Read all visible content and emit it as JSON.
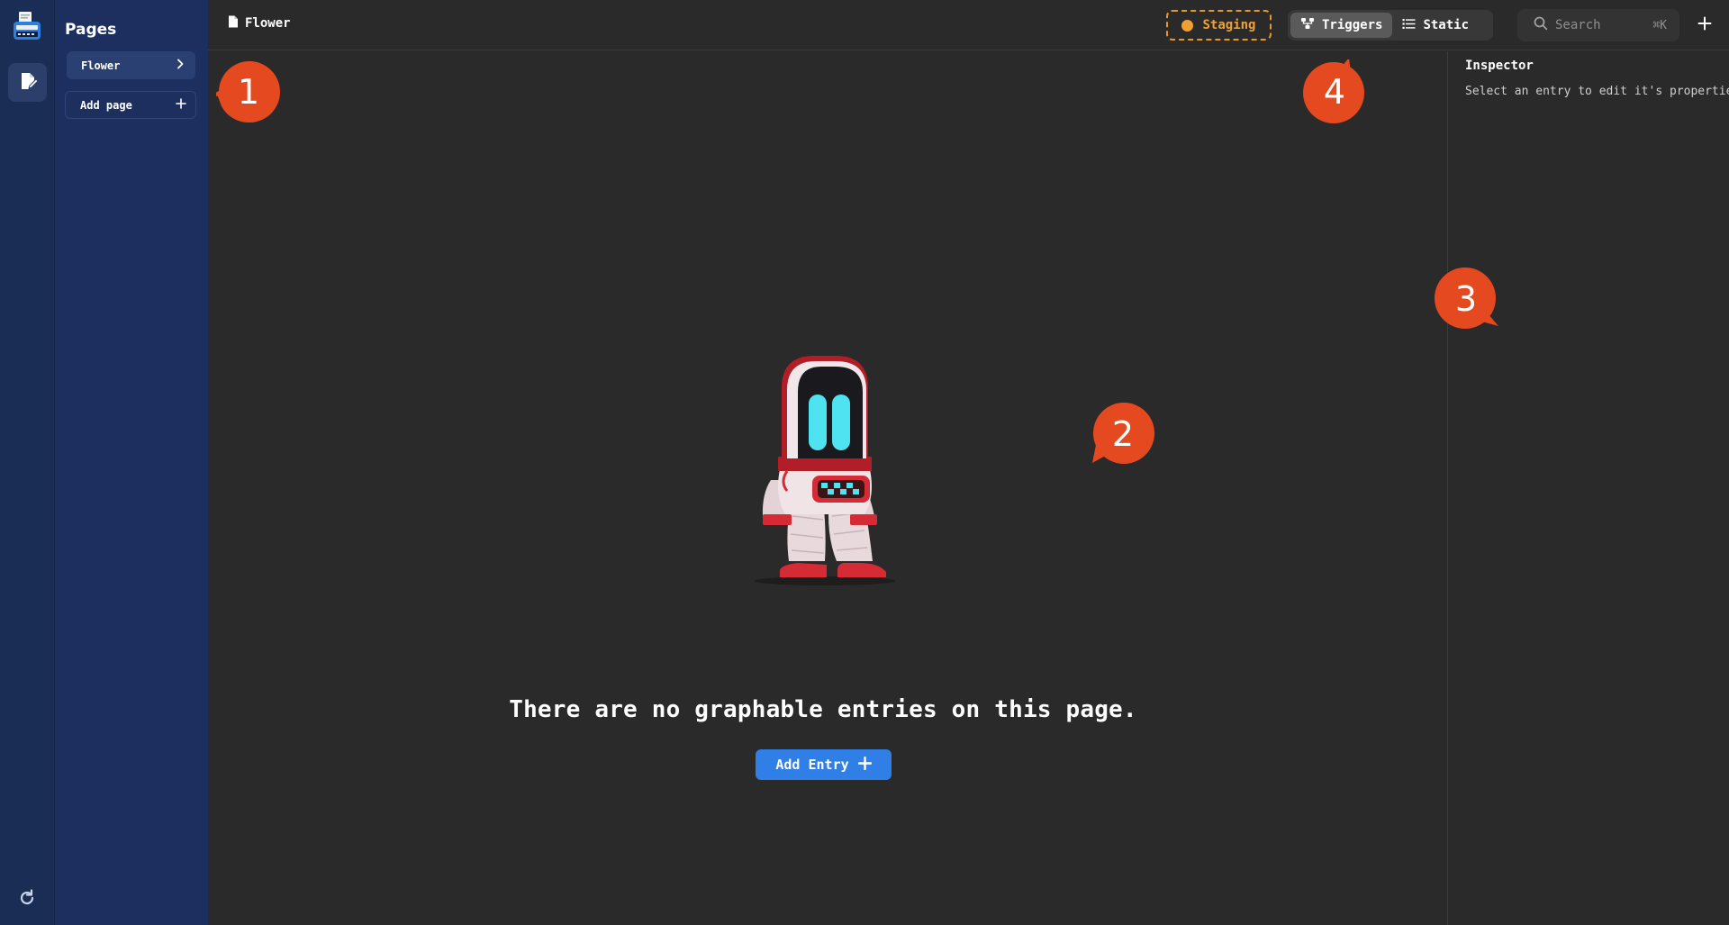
{
  "breadcrumb": {
    "page": "Flower"
  },
  "sidebar": {
    "title": "Pages",
    "items": [
      {
        "label": "Flower"
      }
    ],
    "add_label": "Add page"
  },
  "toolbar": {
    "environment": "Staging",
    "view_toggle": [
      {
        "label": "Triggers",
        "active": true
      },
      {
        "label": "Static",
        "active": false
      }
    ],
    "search_placeholder": "Search",
    "search_shortcut": "⌘K"
  },
  "canvas": {
    "empty_message": "There are no graphable entries on this page.",
    "add_entry_label": "Add Entry"
  },
  "inspector": {
    "title": "Inspector",
    "hint": "Select an entry to edit it's properties"
  },
  "callouts": [
    "1",
    "2",
    "3",
    "4"
  ],
  "colors": {
    "rail": "#1a2d55",
    "sidebar": "#1d2f5f",
    "background": "#2a2a2a",
    "accent": "#2f7fe6",
    "staging": "#f0a135",
    "callout": "#e5491f"
  }
}
